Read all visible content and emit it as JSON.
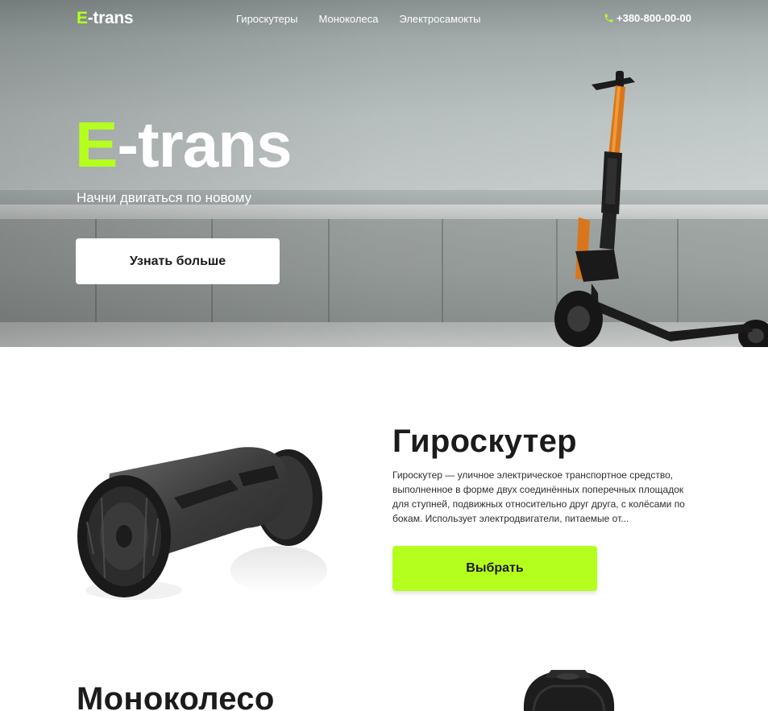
{
  "header": {
    "logo_accent": "E",
    "logo_rest": "-trans",
    "nav": [
      {
        "label": "Гироскутеры"
      },
      {
        "label": "Моноколеса"
      },
      {
        "label": "Электросамокты"
      }
    ],
    "phone": "+380-800-00-00"
  },
  "hero": {
    "title_accent": "E",
    "title_rest": "-trans",
    "tagline": "Начни двигаться по новому",
    "button_label": "Узнать больше"
  },
  "products": [
    {
      "title": "Гироскутер",
      "description": "Гироскутер — уличное электрическое транспортное средство, выполненное в форме двух соединённых поперечных площадок для ступней, подвижных относительно друг друга, с колёсами по бокам. Использует электродвигатели, питаемые от...",
      "button_label": "Выбрать"
    },
    {
      "title": "Моноколесо"
    }
  ],
  "colors": {
    "accent": "#b5ff1f",
    "text": "#1b1b1b",
    "white": "#ffffff"
  },
  "icons": {
    "phone": "phone-icon"
  }
}
